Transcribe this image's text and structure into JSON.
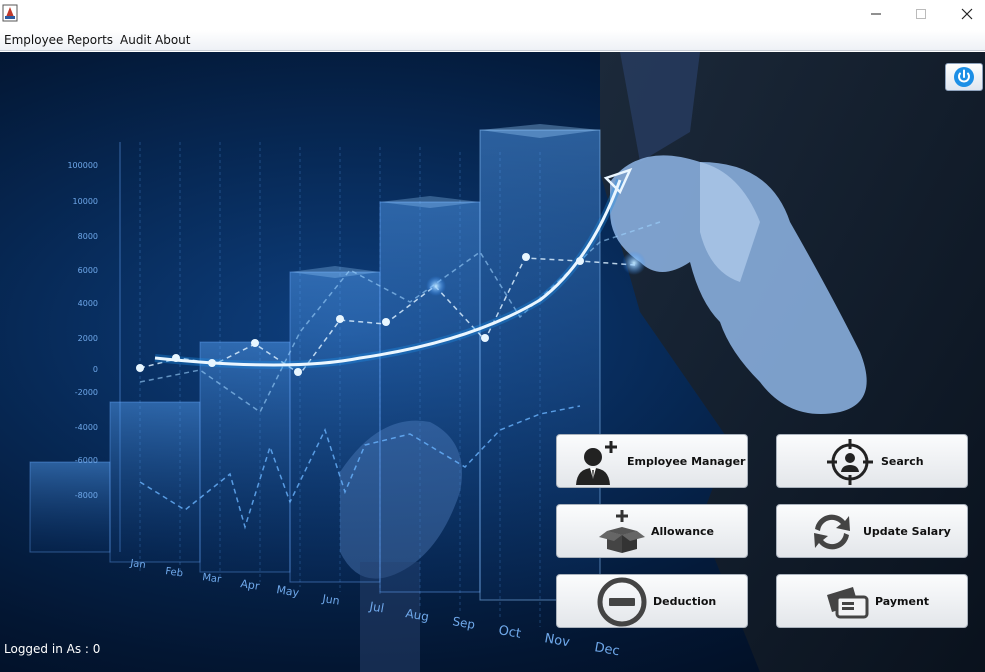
{
  "window": {
    "title": ""
  },
  "menu": {
    "items": [
      "Employee",
      "Reports",
      "Audit",
      "About"
    ]
  },
  "background": {
    "y_ticks": [
      "100000",
      "10000",
      "8000",
      "6000",
      "4000",
      "2000",
      "0",
      "-2000",
      "-4000",
      "-6000",
      "-8000"
    ],
    "months": [
      "Jan",
      "Feb",
      "Mar",
      "Apr",
      "May",
      "Jun",
      "Jul",
      "Aug",
      "Sep",
      "Oct",
      "Nov",
      "Dec"
    ]
  },
  "buttons": {
    "employee_manager": "Employee Manager",
    "search": "Search",
    "allowance": "Allowance",
    "update_salary": "Update Salary",
    "deduction": "Deduction",
    "payment": "Payment"
  },
  "status": {
    "logged_in": "Logged in As : 0"
  },
  "colors": {
    "accent": "#1c8fe8",
    "bg_dark": "#031632",
    "button_face": "#eef0f3"
  }
}
